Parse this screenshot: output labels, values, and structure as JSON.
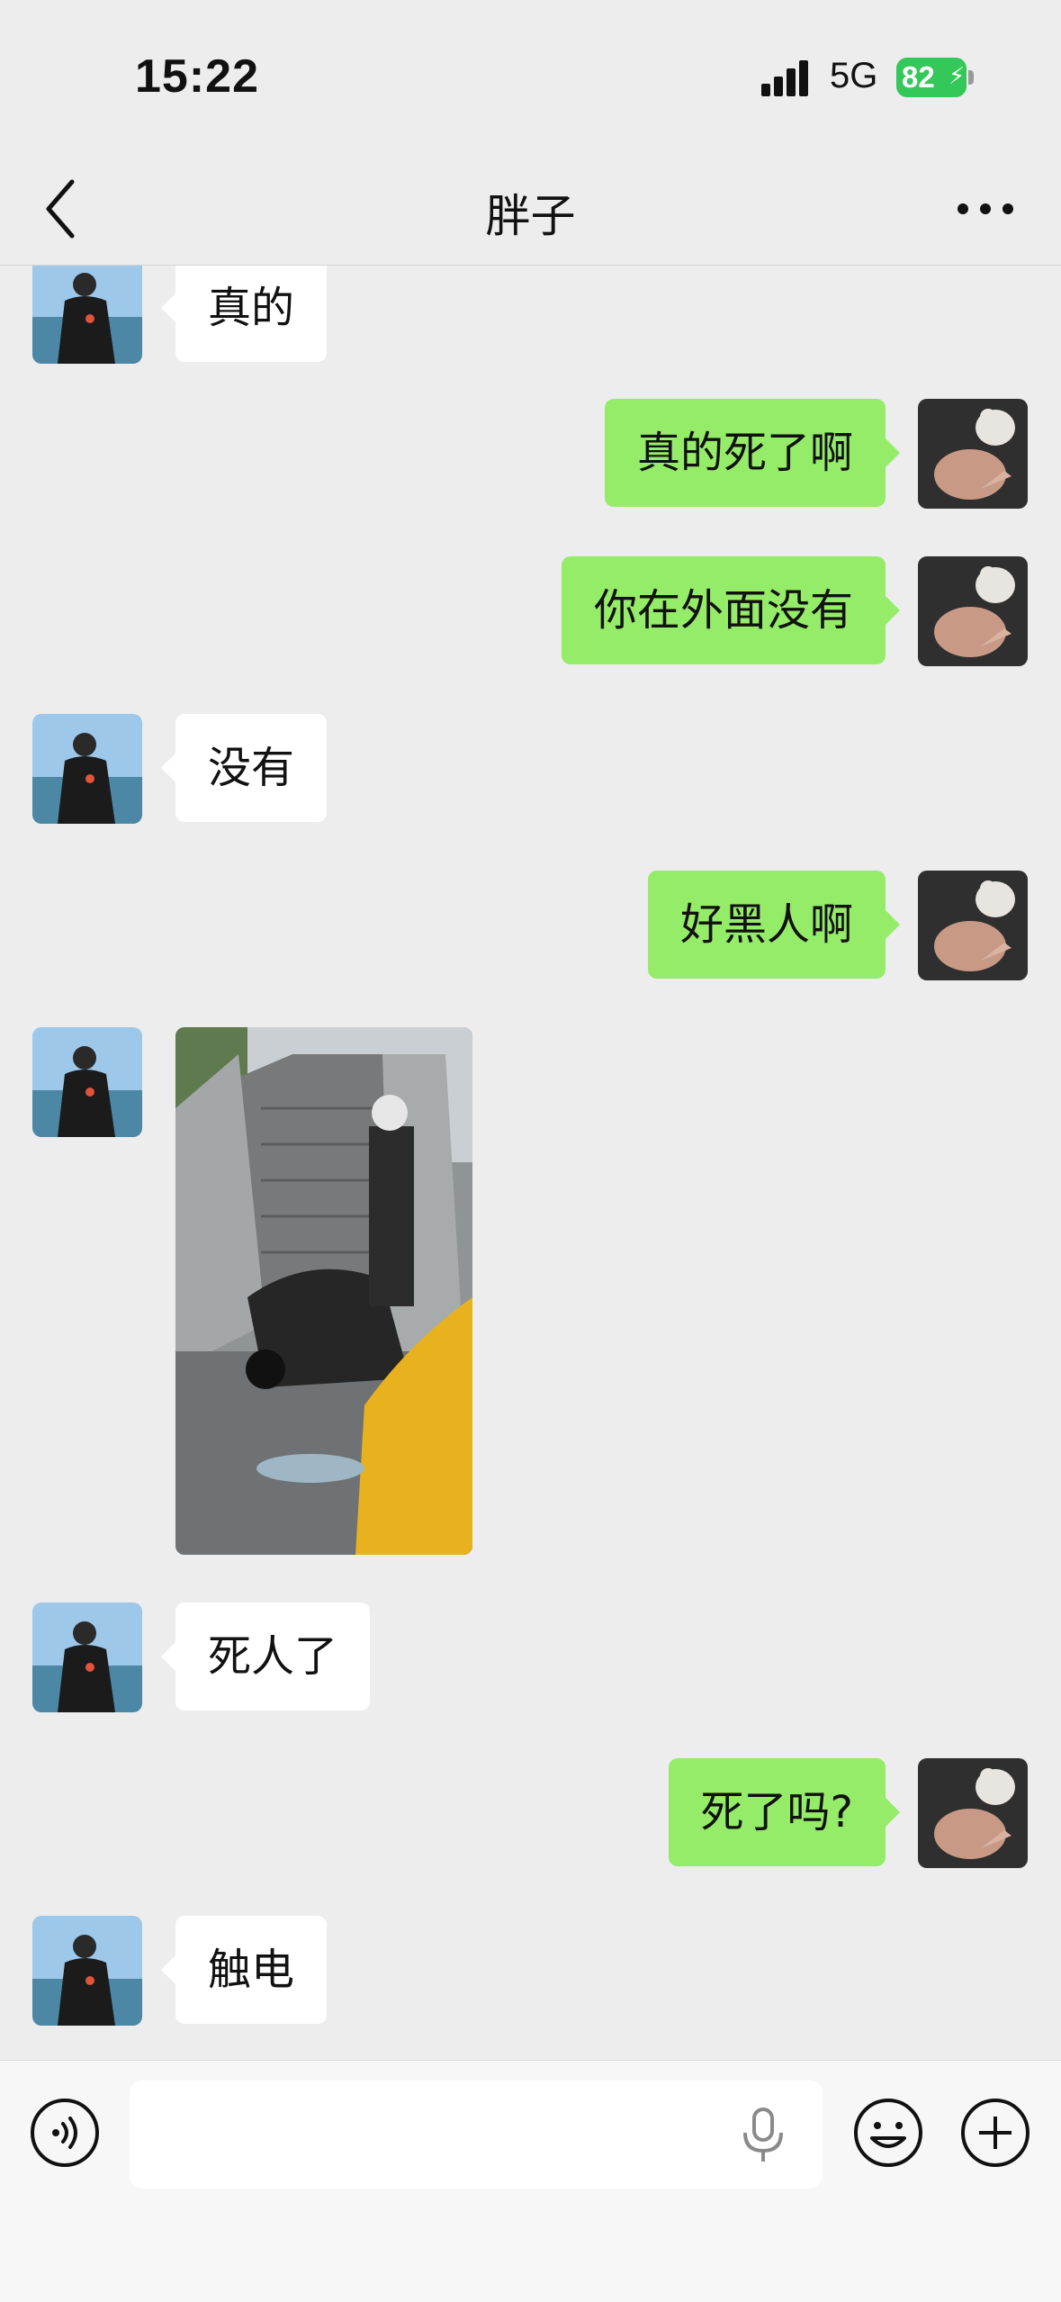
{
  "status_bar": {
    "time": "15:22",
    "network": "5G",
    "battery": "82"
  },
  "header": {
    "title": "胖子"
  },
  "messages": [
    {
      "side": "in",
      "text": "真的"
    },
    {
      "side": "out",
      "text": "真的死了啊"
    },
    {
      "side": "out",
      "text": "你在外面没有"
    },
    {
      "side": "in",
      "text": "没有"
    },
    {
      "side": "out",
      "text": "好黑人啊"
    },
    {
      "side": "in",
      "type": "image"
    },
    {
      "side": "in",
      "text": "死人了"
    },
    {
      "side": "out",
      "text": "死了吗?"
    },
    {
      "side": "in",
      "text": "触电"
    }
  ],
  "input": {
    "value": "",
    "placeholder": ""
  },
  "icons": {
    "back": "chevron-left-icon",
    "more": "more-dots-icon",
    "voice": "voice-icon",
    "mic": "mic-icon",
    "emoji": "emoji-icon",
    "plus": "plus-icon"
  },
  "colors": {
    "outgoing_bubble": "#95ec69",
    "incoming_bubble": "#ffffff",
    "background": "#ededed",
    "battery": "#34c759"
  }
}
